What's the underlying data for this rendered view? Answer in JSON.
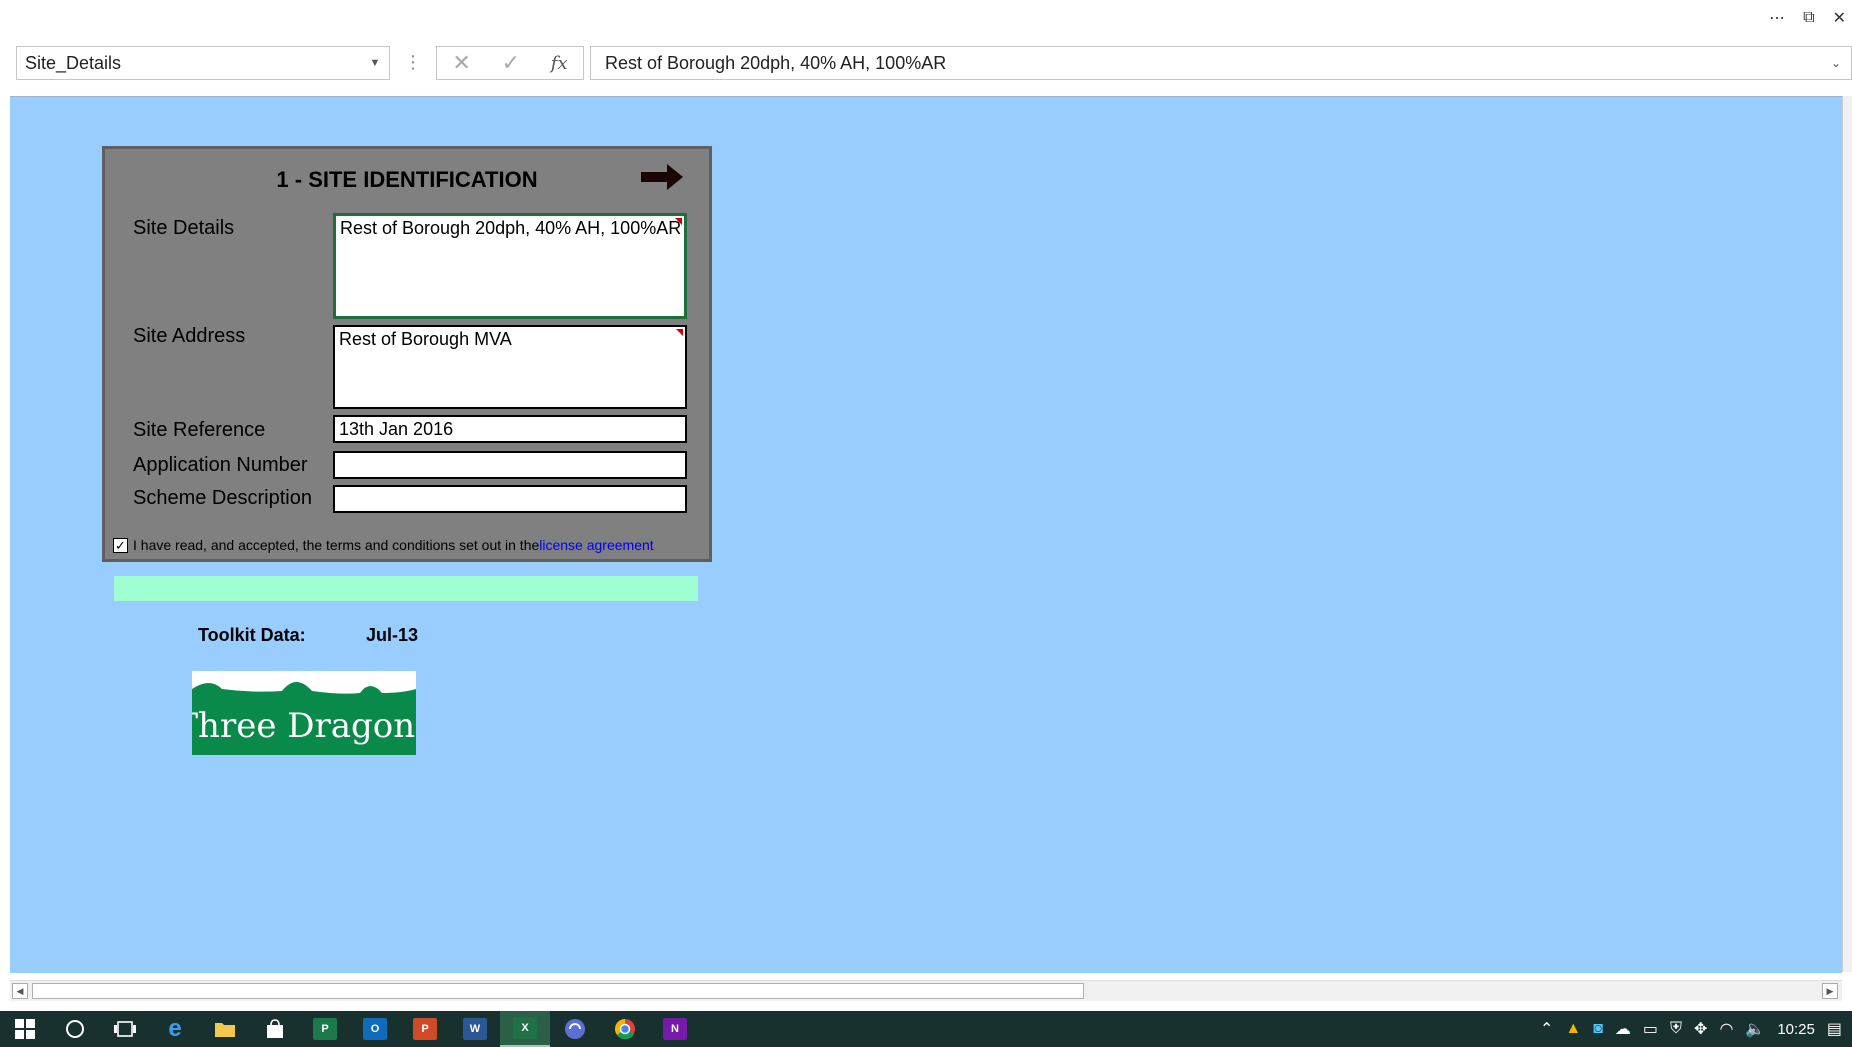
{
  "window": {
    "more_icon": "⋯",
    "restore_icon": "⧉",
    "close_icon": "✕"
  },
  "formula_bar": {
    "name_box": "Site_Details",
    "cancel_icon": "✕",
    "enter_icon": "✓",
    "fx_label": "fx",
    "formula": "Rest of Borough 20dph, 40% AH, 100%AR"
  },
  "panel": {
    "title": "1 - SITE IDENTIFICATION",
    "fields": {
      "site_details_label": "Site Details",
      "site_details_value": "Rest of Borough 20dph, 40% AH, 100%AR",
      "site_address_label": "Site Address",
      "site_address_value": "Rest of Borough MVA",
      "site_reference_label": "Site Reference",
      "site_reference_value": "13th Jan 2016",
      "application_number_label": "Application Number",
      "application_number_value": "",
      "scheme_description_label": "Scheme Description",
      "scheme_description_value": ""
    },
    "license_checked": true,
    "license_text": "I have read, and accepted, the terms and conditions set out in the",
    "license_link": "license agreement"
  },
  "toolkit": {
    "label": "Toolkit Data:",
    "value": "Jul-13"
  },
  "logo": {
    "text": "Three Dragons",
    "color": "#0a8a4a"
  },
  "taskbar": {
    "clock": "10:25",
    "apps": [
      "windows-start",
      "cortana",
      "task-view",
      "edge",
      "file-explorer",
      "store",
      "publisher",
      "outlook",
      "powerpoint",
      "word",
      "excel",
      "sync",
      "chrome",
      "onenote"
    ],
    "app_letters": {
      "publisher": "P",
      "outlook": "O",
      "powerpoint": "P",
      "word": "W",
      "excel": "X",
      "onenote": "N"
    }
  }
}
